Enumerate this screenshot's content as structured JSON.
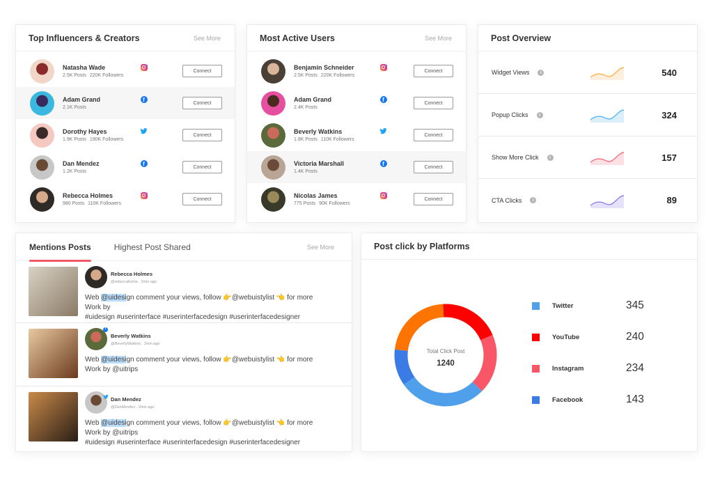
{
  "influencers": {
    "title": "Top Influencers & Creators",
    "see_more": "See More",
    "connect_label": "Connect",
    "items": [
      {
        "name": "Natasha Wade",
        "posts": "2.5K Posts",
        "followers": "220K Followers",
        "platform": "instagram",
        "avatar_colors": [
          "#f2d6c8",
          "#8a2b2b"
        ]
      },
      {
        "name": "Adam Grand",
        "posts": "2.1K Posts",
        "followers": "",
        "platform": "facebook",
        "avatar_colors": [
          "#3ab8e0",
          "#3a2a5e"
        ]
      },
      {
        "name": "Dorothy Hayes",
        "posts": "1.9K Posts",
        "followers": "190K Followers",
        "platform": "twitter",
        "avatar_colors": [
          "#f5c9c2",
          "#3b2a2a"
        ]
      },
      {
        "name": "Dan Mendez",
        "posts": "1.2K Posts",
        "followers": "",
        "platform": "facebook",
        "avatar_colors": [
          "#c7c7c7",
          "#6b4a35"
        ]
      },
      {
        "name": "Rebecca Holmes",
        "posts": "980 Posts",
        "followers": "110K Followers",
        "platform": "instagram",
        "avatar_colors": [
          "#2e2a26",
          "#d6a98b"
        ]
      }
    ]
  },
  "active_users": {
    "title": "Most Active Users",
    "see_more": "See More",
    "connect_label": "Connect",
    "items": [
      {
        "name": "Benjamin Schneider",
        "posts": "2.5K Posts",
        "followers": "220K Followers",
        "platform": "instagram",
        "avatar_colors": [
          "#4a4036",
          "#d9b59a"
        ]
      },
      {
        "name": "Adam Grand",
        "posts": "2.4K Posts",
        "followers": "",
        "platform": "facebook",
        "avatar_colors": [
          "#e64fa0",
          "#4a2a1e"
        ]
      },
      {
        "name": "Beverly Watkins",
        "posts": "1.8K Posts",
        "followers": "110K Followers",
        "platform": "twitter",
        "avatar_colors": [
          "#5a6a3a",
          "#c96a5a"
        ]
      },
      {
        "name": "Victoria Marshall",
        "posts": "1.4K Posts",
        "followers": "",
        "platform": "facebook",
        "avatar_colors": [
          "#b9a595",
          "#6b4a3a"
        ]
      },
      {
        "name": "Nicolas James",
        "posts": "775 Posts",
        "followers": "90K Followers",
        "platform": "instagram",
        "avatar_colors": [
          "#3a3a2a",
          "#9a8a5a"
        ]
      }
    ]
  },
  "post_overview": {
    "title": "Post Overview",
    "items": [
      {
        "label": "Widget Views",
        "value": "540",
        "color": "#f9b54a",
        "fill": "#fdeede"
      },
      {
        "label": "Popup Clicks",
        "value": "324",
        "color": "#5bb8f5",
        "fill": "#daeefc"
      },
      {
        "label": "Show More Click",
        "value": "157",
        "color": "#f5707e",
        "fill": "#fde0e3"
      },
      {
        "label": "CTA Clicks",
        "value": "89",
        "color": "#8f7ff0",
        "fill": "#e6e2fd"
      }
    ]
  },
  "mentions": {
    "tabs": [
      {
        "label": "Mentions Posts",
        "active": true
      },
      {
        "label": "Highest Post Shared",
        "active": false
      }
    ],
    "see_more": "See More",
    "posts": [
      {
        "name": "Rebecca Holmes",
        "handle": "@rebeccahome . 2min ago",
        "platform": "instagram",
        "text_pre": "Web ",
        "mention": "@uidesi",
        "text_post": "gn comment your views, follow 👉@webuistylist 👈 for more",
        "line2": "Work by",
        "line3": "#uidesign #userinterface #userinterfacedesign #userinterfacedesigner",
        "img_colors": [
          "#d9d2c5",
          "#8a7a66"
        ],
        "avatar_colors": [
          "#2e2a26",
          "#d6a98b"
        ]
      },
      {
        "name": "Beverly Watkins",
        "handle": "@BeverlyWatkins . 2min ago",
        "platform": "facebook",
        "text_pre": "Web ",
        "mention": "@uidesi",
        "text_post": "gn comment your views, follow 👉@webuistylist 👈 for more",
        "line2": "Work by @uitrips",
        "line3": "",
        "img_colors": [
          "#e8c9a0",
          "#6b3a1e"
        ],
        "avatar_colors": [
          "#5a6a3a",
          "#c96a5a"
        ]
      },
      {
        "name": "Dan Mendez",
        "handle": "@DanMendez . 2min ago",
        "platform": "twitter",
        "text_pre": "Web ",
        "mention": "@uidesi",
        "text_post": "gn comment your views, follow 👉@webuistylist 👈 for more",
        "line2": "Work by @uitrips",
        "line3": "#uidesign #userinterface #userinterfacedesign #userinterfacedesigner",
        "img_colors": [
          "#c98a4a",
          "#2a1e16"
        ],
        "avatar_colors": [
          "#c7c7c7",
          "#6b4a35"
        ]
      }
    ]
  },
  "platform_chart": {
    "title": "Post click by Platforms",
    "center_label": "Total Click Post",
    "center_value": "1240"
  },
  "chart_data": {
    "type": "pie",
    "title": "Post click by Platforms",
    "total_label": "Total Click Post",
    "total": 1240,
    "legend_placement": "right",
    "series": [
      {
        "name": "Twitter",
        "value": 345,
        "color": "#4f9fea"
      },
      {
        "name": "YouTube",
        "value": 240,
        "color": "#ff0000"
      },
      {
        "name": "Instagram",
        "value": 234,
        "color": "#f95667"
      },
      {
        "name": "Facebook",
        "value": 143,
        "color": "#3b7be6"
      }
    ],
    "unlabeled_segments": [
      {
        "name": "",
        "value": 278,
        "color": "#fd7400"
      }
    ]
  }
}
